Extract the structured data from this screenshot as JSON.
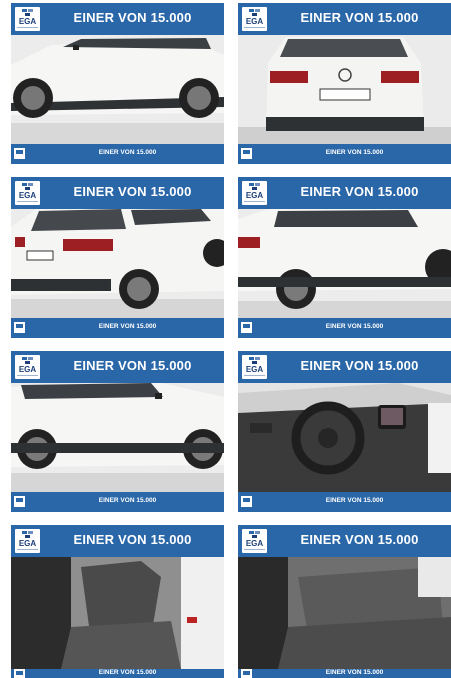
{
  "listing": {
    "cards": [
      {
        "banner": "EINER VON 15.000",
        "logo": "EGA",
        "footer": "EINER VON 15.000",
        "photo": "side-right"
      },
      {
        "banner": "EINER VON 15.000",
        "logo": "EGA",
        "footer": "EINER VON 15.000",
        "photo": "rear"
      },
      {
        "banner": "EINER VON 15.000",
        "logo": "EGA",
        "footer": "EINER VON 15.000",
        "photo": "rear-left"
      },
      {
        "banner": "EINER VON 15.000",
        "logo": "EGA",
        "footer": "EINER VON 15.000",
        "photo": "side-rear"
      },
      {
        "banner": "EINER VON 15.000",
        "logo": "EGA",
        "footer": "EINER VON 15.000",
        "photo": "side-front"
      },
      {
        "banner": "EINER VON 15.000",
        "logo": "EGA",
        "footer": "EINER VON 15.000",
        "photo": "cockpit"
      },
      {
        "banner": "EINER VON 15.000",
        "logo": "EGA",
        "footer": "EINER VON 15.000",
        "photo": "front-seats"
      },
      {
        "banner": "EINER VON 15.000",
        "logo": "EGA",
        "footer": "EINER VON 15.000",
        "photo": "rear-seats"
      }
    ]
  },
  "colors": {
    "brand_blue": "#2a67a8",
    "car_white": "#f4f4f2",
    "interior_dark": "#3b3b3b"
  }
}
